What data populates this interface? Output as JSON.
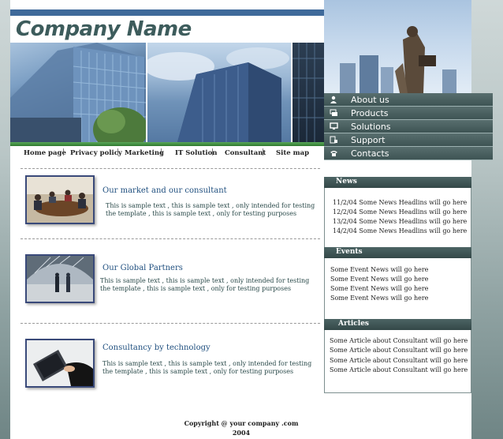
{
  "brand": {
    "company_name": "Company Name"
  },
  "menu": [
    {
      "label": "About us",
      "icon": "person-icon"
    },
    {
      "label": "Products",
      "icon": "products-icon"
    },
    {
      "label": "Solutions",
      "icon": "monitor-icon"
    },
    {
      "label": "Support",
      "icon": "support-icon"
    },
    {
      "label": "Contacts",
      "icon": "phone-icon"
    }
  ],
  "nav": [
    {
      "label": "Home page"
    },
    {
      "label": "Privacy policy"
    },
    {
      "label": "Marketing"
    },
    {
      "label": "IT Solution"
    },
    {
      "label": "Consultant"
    },
    {
      "label": "Site map"
    }
  ],
  "nav_separator": "|",
  "sections": [
    {
      "title": "Our market and our consultant",
      "body": "This is sample text , this is sample text , only intended for testing the template , this is sample text , only for testing purposes"
    },
    {
      "title": "Our Global Partners",
      "body": "This is sample text , this is sample text , only intended for testing the template , this is sample text , only for testing purposes"
    },
    {
      "title": "Consultancy by technology",
      "body": "This is sample text , this is sample text , only intended for testing the template , this is sample text , only for testing purposes"
    }
  ],
  "news": {
    "heading": "News",
    "items": [
      "11/2/04  Some News Headlins will go here",
      "12/2/04  Some News Headlins will go here",
      "13/2/04  Some News Headlins will go here",
      "14/2/04  Some News Headlins will go here"
    ]
  },
  "events": {
    "heading": "Events",
    "items": [
      "Some Event News will go here",
      "Some Event News will go here",
      "Some Event News will go here",
      "Some Event News will go here"
    ]
  },
  "articles": {
    "heading": "Articles",
    "items": [
      "Some Article about Consultant will go here",
      "Some Article about Consultant will go here",
      "Some Article about Consultant will go here",
      "Some Article about Consultant will go here"
    ]
  },
  "footer": {
    "line1": "Copyright @ your company .com",
    "line2": "2004"
  },
  "colors": {
    "accent_blue": "#3f6a9a",
    "menu_dark": "#3e5454",
    "heading_teal": "#3d5c5c",
    "title_blue": "#1f4f7f"
  }
}
